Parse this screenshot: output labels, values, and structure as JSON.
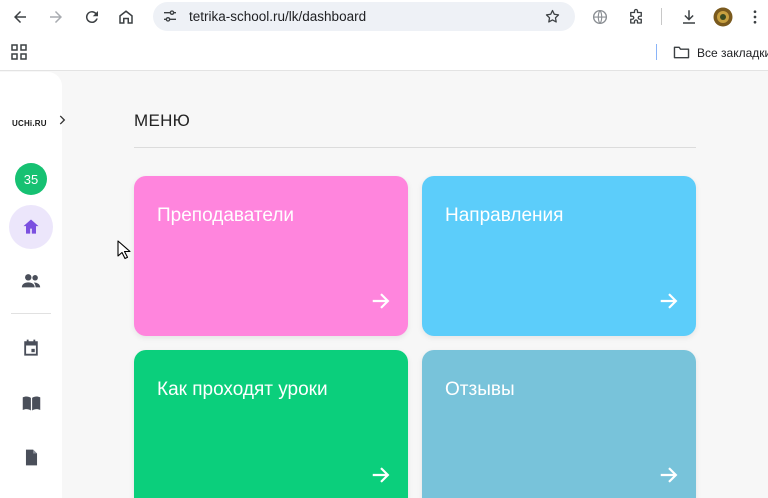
{
  "browser": {
    "url": "tetrika-school.ru/lk/dashboard",
    "bookmarks_all_label": "Все закладки"
  },
  "sidebar": {
    "logo_text": "UCHi.RU",
    "badge_count": "35",
    "accent_color": "#16c172"
  },
  "main": {
    "menu_title": "МЕНЮ",
    "cards": [
      {
        "title": "Преподаватели",
        "color": "#ff85dd"
      },
      {
        "title": "Направления",
        "color": "#5ccdfa"
      },
      {
        "title": "Как проходят уроки",
        "color": "#0bcf7c"
      },
      {
        "title": "Отзывы",
        "color": "#78c3da"
      }
    ]
  }
}
